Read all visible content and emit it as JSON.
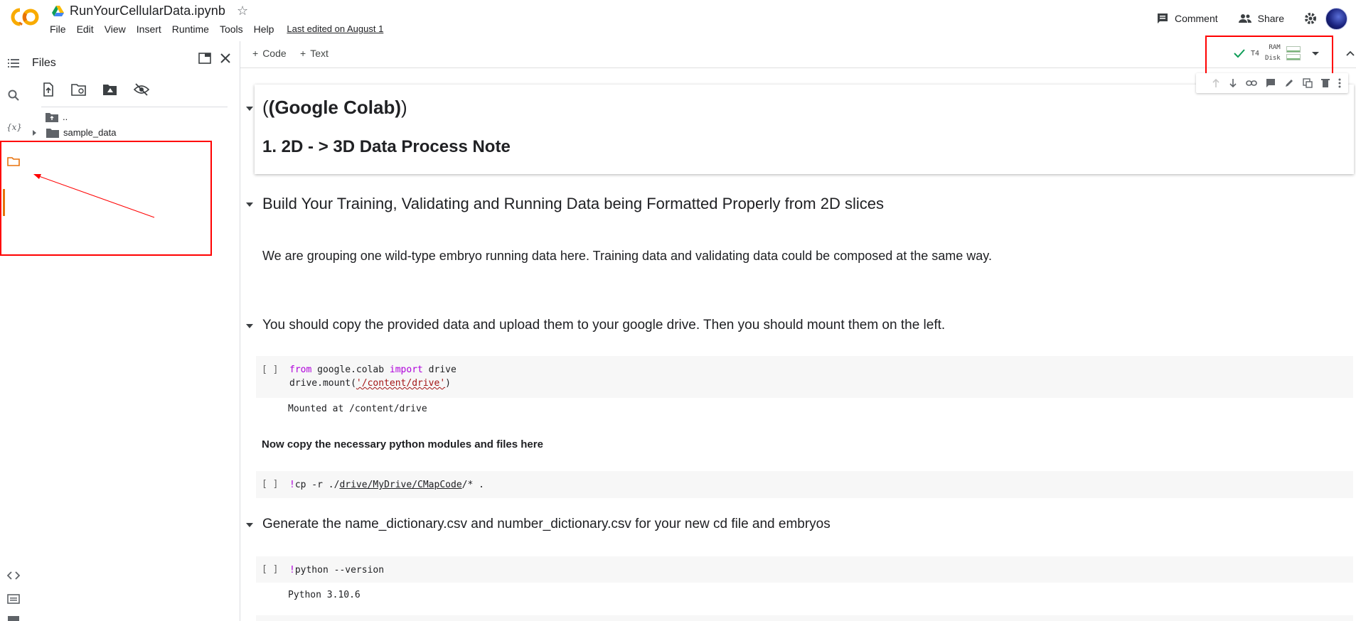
{
  "header": {
    "notebook_title": "RunYourCellularData.ipynb",
    "menu": [
      "File",
      "Edit",
      "View",
      "Insert",
      "Runtime",
      "Tools",
      "Help"
    ],
    "last_edited": "Last edited on August 1",
    "comment_label": "Comment",
    "share_label": "Share"
  },
  "files_pane": {
    "title": "Files",
    "parent_dir": "..",
    "items": [
      "sample_data"
    ]
  },
  "toolbar": {
    "add_code": "Code",
    "add_text": "Text",
    "runtime": {
      "gpu": "T4",
      "ram_label": "RAM",
      "disk_label": "Disk",
      "status": "connected"
    }
  },
  "cells": {
    "md1_line1": "(Google Colab)",
    "md1_line2": "1. 2D - > 3D Data Process Note",
    "md2_heading": "Build Your Training, Validating and Running Data being Formatted Properly from 2D slices",
    "md3_paragraph": "We are grouping one wild-type embryo running data here. Training data and validating data could be composed at the same way.",
    "md4_heading": "You should copy the provided data and upload them to your google drive. Then you should mount them on the left.",
    "code1_bracket": "[ ]",
    "code1_output": "Mounted at /content/drive",
    "note_bold": "Now copy the necessary python modules and files here",
    "code2_bracket": "[ ]",
    "md5_heading": "Generate the name_dictionary.csv and number_dictionary.csv for your new cd file and embryos",
    "code3_bracket": "[ ]",
    "code3_source": "python --version",
    "code3_output": "Python 3.10.6"
  },
  "colors": {
    "accent_orange": "#e8710a",
    "highlight_red": "#ff0000",
    "keyword_purple": "#af00db",
    "string_red": "#a31515"
  }
}
